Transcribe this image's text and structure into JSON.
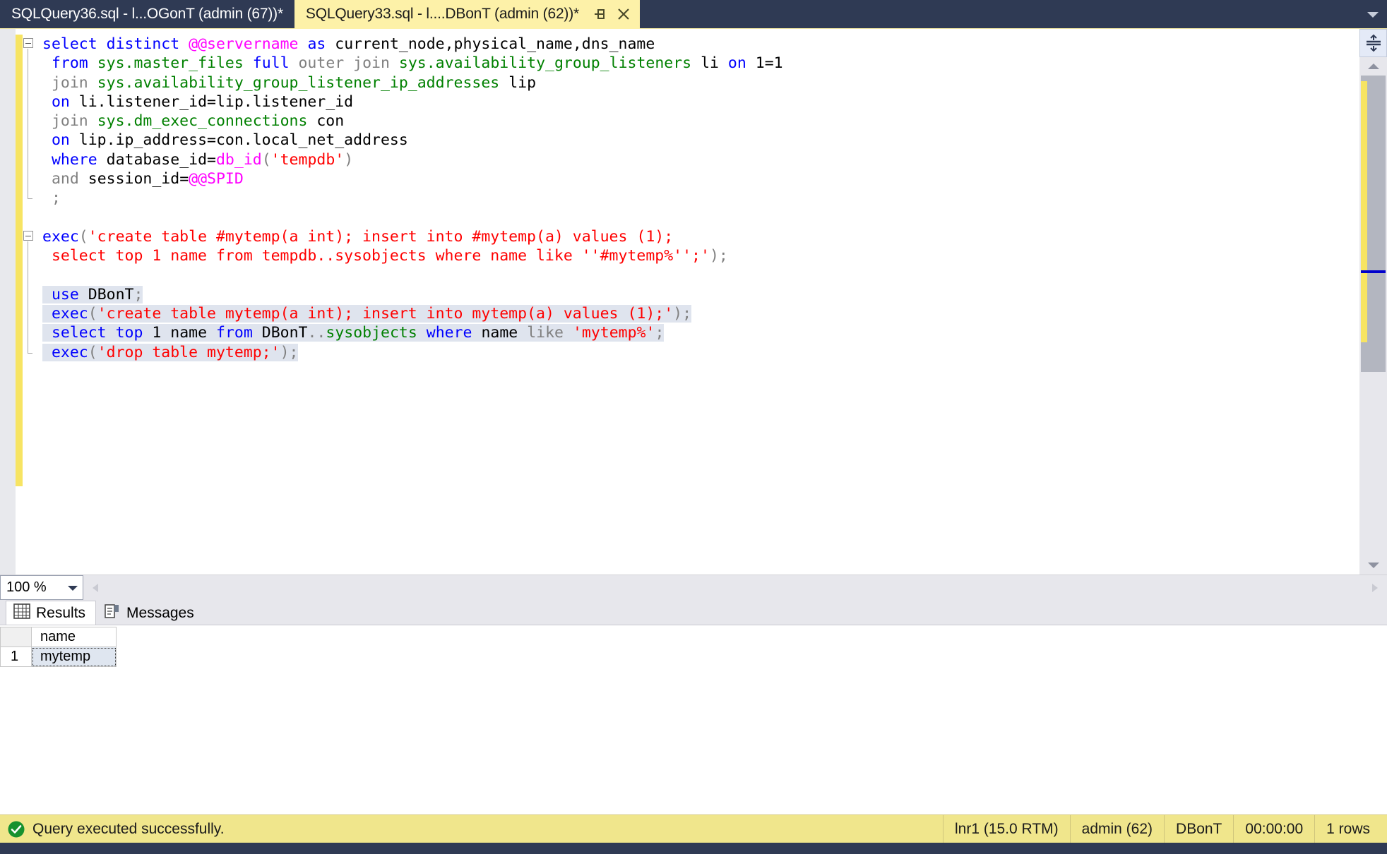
{
  "window": {
    "accent_dark": "#2f3a54",
    "tab_active_bg": "#fdf1a8",
    "status_bg": "#f0e68c"
  },
  "tabs": [
    {
      "label": "SQLQuery36.sql - l...OGonT (admin (67))*",
      "active": false,
      "name": "tab-sqlquery36"
    },
    {
      "label": "SQLQuery33.sql - l....DBonT (admin (62))*",
      "active": true,
      "name": "tab-sqlquery33"
    }
  ],
  "tab_controls": {
    "pin_icon": "pin-icon",
    "close_icon": "close-icon",
    "dropdown_icon": "chevron-down-icon"
  },
  "editor": {
    "lines": [
      {
        "indent": 0,
        "fold": "start",
        "selected": false,
        "tokens": [
          {
            "t": "select",
            "c": "kw"
          },
          {
            "t": " ",
            "c": "pln"
          },
          {
            "t": "distinct",
            "c": "kw"
          },
          {
            "t": " ",
            "c": "pln"
          },
          {
            "t": "@@servername",
            "c": "var"
          },
          {
            "t": " ",
            "c": "pln"
          },
          {
            "t": "as",
            "c": "kw"
          },
          {
            "t": " ",
            "c": "pln"
          },
          {
            "t": "current_node,physical_name,dns_name",
            "c": "pln"
          }
        ]
      },
      {
        "indent": 1,
        "selected": false,
        "tokens": [
          {
            "t": "from",
            "c": "kw"
          },
          {
            "t": " ",
            "c": "pln"
          },
          {
            "t": "sys.master_files",
            "c": "obj"
          },
          {
            "t": " ",
            "c": "pln"
          },
          {
            "t": "full",
            "c": "kw"
          },
          {
            "t": " ",
            "c": "pln"
          },
          {
            "t": "outer",
            "c": "kwg"
          },
          {
            "t": " ",
            "c": "pln"
          },
          {
            "t": "join",
            "c": "kwg"
          },
          {
            "t": " ",
            "c": "pln"
          },
          {
            "t": "sys.availability_group_listeners",
            "c": "obj"
          },
          {
            "t": " ",
            "c": "pln"
          },
          {
            "t": "li",
            "c": "pln"
          },
          {
            "t": " ",
            "c": "pln"
          },
          {
            "t": "on",
            "c": "kw"
          },
          {
            "t": " ",
            "c": "pln"
          },
          {
            "t": "1=1",
            "c": "pln"
          }
        ]
      },
      {
        "indent": 1,
        "selected": false,
        "tokens": [
          {
            "t": "join",
            "c": "kwg"
          },
          {
            "t": " ",
            "c": "pln"
          },
          {
            "t": "sys.availability_group_listener_ip_addresses",
            "c": "obj"
          },
          {
            "t": " ",
            "c": "pln"
          },
          {
            "t": "lip",
            "c": "pln"
          }
        ]
      },
      {
        "indent": 1,
        "selected": false,
        "tokens": [
          {
            "t": "on",
            "c": "kw"
          },
          {
            "t": " ",
            "c": "pln"
          },
          {
            "t": "li.listener_id=lip.listener_id",
            "c": "pln"
          }
        ]
      },
      {
        "indent": 1,
        "selected": false,
        "tokens": [
          {
            "t": "join",
            "c": "kwg"
          },
          {
            "t": " ",
            "c": "pln"
          },
          {
            "t": "sys.dm_exec_connections",
            "c": "obj"
          },
          {
            "t": " ",
            "c": "pln"
          },
          {
            "t": "con",
            "c": "pln"
          }
        ]
      },
      {
        "indent": 1,
        "selected": false,
        "tokens": [
          {
            "t": "on",
            "c": "kw"
          },
          {
            "t": " ",
            "c": "pln"
          },
          {
            "t": "lip.ip_address=con.local_net_address",
            "c": "pln"
          }
        ]
      },
      {
        "indent": 1,
        "selected": false,
        "tokens": [
          {
            "t": "where",
            "c": "kw"
          },
          {
            "t": " ",
            "c": "pln"
          },
          {
            "t": "database_id=",
            "c": "pln"
          },
          {
            "t": "db_id",
            "c": "fn"
          },
          {
            "t": "(",
            "c": "pun"
          },
          {
            "t": "'tempdb'",
            "c": "str"
          },
          {
            "t": ")",
            "c": "pun"
          }
        ]
      },
      {
        "indent": 1,
        "selected": false,
        "tokens": [
          {
            "t": "and",
            "c": "kwg"
          },
          {
            "t": " ",
            "c": "pln"
          },
          {
            "t": "session_id=",
            "c": "pln"
          },
          {
            "t": "@@SPID",
            "c": "var"
          }
        ]
      },
      {
        "indent": 1,
        "fold": "end",
        "selected": false,
        "tokens": [
          {
            "t": ";",
            "c": "pun"
          }
        ]
      },
      {
        "indent": 1,
        "selected": false,
        "tokens": []
      },
      {
        "indent": 0,
        "fold": "start",
        "selected": false,
        "tokens": [
          {
            "t": "exec",
            "c": "kw"
          },
          {
            "t": "(",
            "c": "pun"
          },
          {
            "t": "'create table #mytemp(a int); insert into #mytemp(a) values (1);",
            "c": "str"
          }
        ]
      },
      {
        "indent": 1,
        "selected": false,
        "tokens": [
          {
            "t": "select top 1 name from tempdb..sysobjects where name like ''#mytemp%'';'",
            "c": "str"
          },
          {
            "t": ")",
            "c": "pun"
          },
          {
            "t": ";",
            "c": "pun"
          }
        ]
      },
      {
        "indent": 1,
        "selected": false,
        "tokens": []
      },
      {
        "indent": 1,
        "selected": true,
        "tokens": [
          {
            "t": "use",
            "c": "kw"
          },
          {
            "t": " ",
            "c": "pln"
          },
          {
            "t": "DBonT",
            "c": "pln"
          },
          {
            "t": ";",
            "c": "pun"
          }
        ]
      },
      {
        "indent": 1,
        "selected": true,
        "tokens": [
          {
            "t": "exec",
            "c": "kw"
          },
          {
            "t": "(",
            "c": "pun"
          },
          {
            "t": "'create table mytemp(a int); insert into mytemp(a) values (1);'",
            "c": "str"
          },
          {
            "t": ")",
            "c": "pun"
          },
          {
            "t": ";",
            "c": "pun"
          }
        ]
      },
      {
        "indent": 1,
        "selected": true,
        "tokens": [
          {
            "t": "select",
            "c": "kw"
          },
          {
            "t": " ",
            "c": "pln"
          },
          {
            "t": "top",
            "c": "kw"
          },
          {
            "t": " ",
            "c": "pln"
          },
          {
            "t": "1",
            "c": "pln"
          },
          {
            "t": " ",
            "c": "pln"
          },
          {
            "t": "name",
            "c": "pln"
          },
          {
            "t": " ",
            "c": "pln"
          },
          {
            "t": "from",
            "c": "kw"
          },
          {
            "t": " ",
            "c": "pln"
          },
          {
            "t": "DBonT",
            "c": "pln"
          },
          {
            "t": "..",
            "c": "pun"
          },
          {
            "t": "sysobjects",
            "c": "obj"
          },
          {
            "t": " ",
            "c": "pln"
          },
          {
            "t": "where",
            "c": "kw"
          },
          {
            "t": " ",
            "c": "pln"
          },
          {
            "t": "name",
            "c": "pln"
          },
          {
            "t": " ",
            "c": "pln"
          },
          {
            "t": "like",
            "c": "kwg"
          },
          {
            "t": " ",
            "c": "pln"
          },
          {
            "t": "'mytemp%'",
            "c": "str"
          },
          {
            "t": ";",
            "c": "pun"
          }
        ]
      },
      {
        "indent": 1,
        "fold": "end",
        "selected": true,
        "tokens": [
          {
            "t": "exec",
            "c": "kw"
          },
          {
            "t": "(",
            "c": "pun"
          },
          {
            "t": "'drop table mytemp;'",
            "c": "str"
          },
          {
            "t": ")",
            "c": "pun"
          },
          {
            "t": ";",
            "c": "pun"
          }
        ]
      }
    ]
  },
  "zoombar": {
    "zoom_level": "100 %",
    "dropdown_icon": "chevron-down-icon",
    "left_arrow_icon": "arrow-left-icon",
    "right_arrow_icon": "arrow-right-icon"
  },
  "results": {
    "tabs": [
      {
        "label": "Results",
        "icon": "grid-icon",
        "active": true,
        "name": "tab-results"
      },
      {
        "label": "Messages",
        "icon": "message-icon",
        "active": false,
        "name": "tab-messages"
      }
    ],
    "grid": {
      "columns": [
        "name"
      ],
      "rows": [
        {
          "num": "1",
          "cells": [
            "mytemp"
          ]
        }
      ]
    }
  },
  "statusbar": {
    "icon": "success-check-icon",
    "message": "Query executed successfully.",
    "cells": [
      {
        "label": "lnr1 (15.0 RTM)",
        "name": "status-server"
      },
      {
        "label": "admin (62)",
        "name": "status-user"
      },
      {
        "label": "DBonT",
        "name": "status-database"
      },
      {
        "label": "00:00:00",
        "name": "status-elapsed"
      },
      {
        "label": "1 rows",
        "name": "status-rowcount"
      }
    ]
  }
}
